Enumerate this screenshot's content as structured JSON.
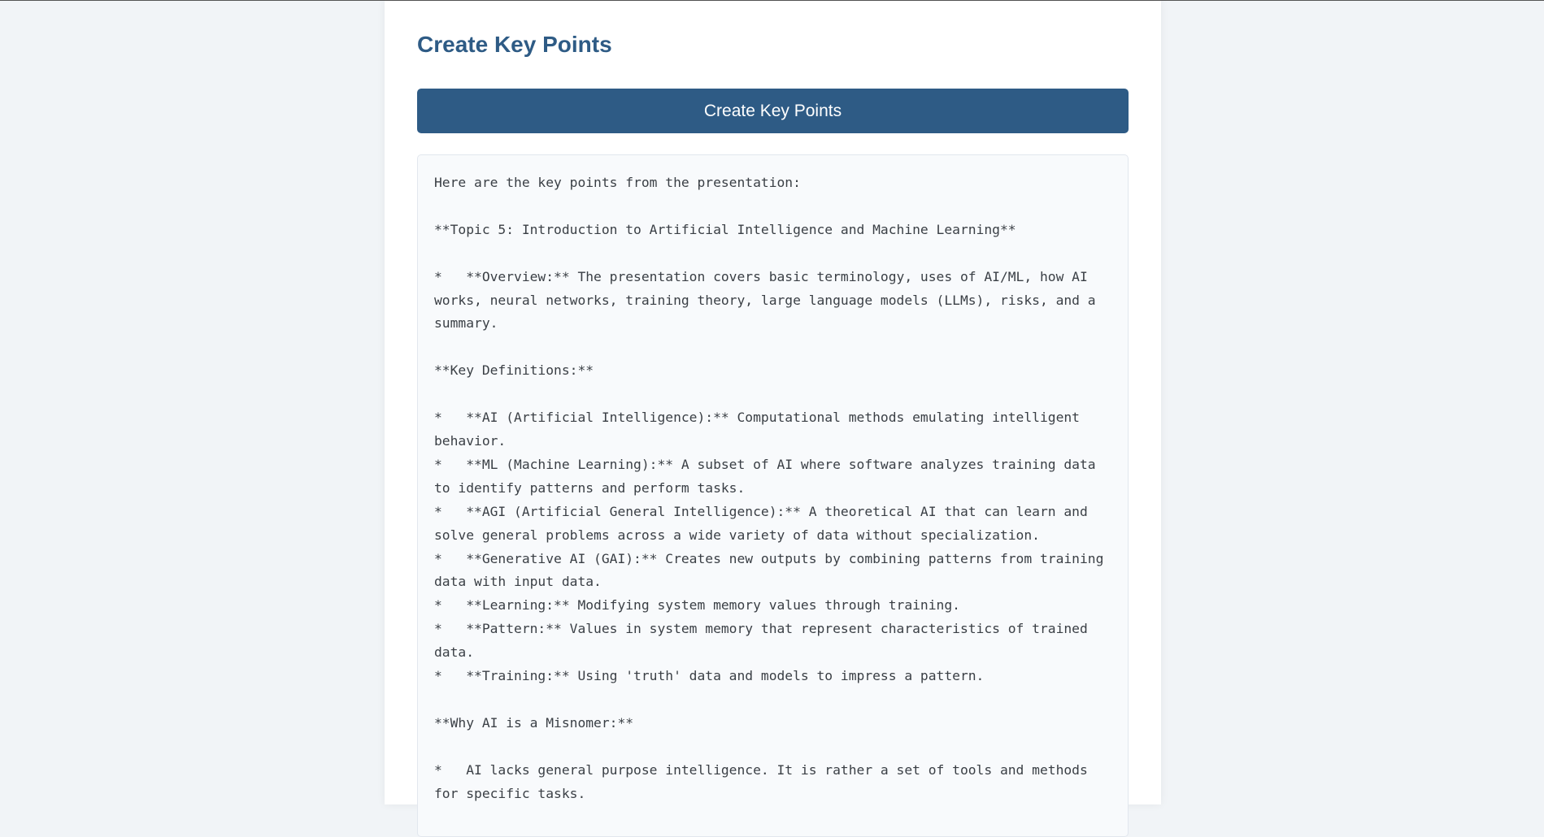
{
  "page": {
    "title": "Create Key Points",
    "button_label": "Create Key Points",
    "output_text": "Here are the key points from the presentation:\n\n**Topic 5: Introduction to Artificial Intelligence and Machine Learning**\n\n*   **Overview:** The presentation covers basic terminology, uses of AI/ML, how AI works, neural networks, training theory, large language models (LLMs), risks, and a summary.\n\n**Key Definitions:**\n\n*   **AI (Artificial Intelligence):** Computational methods emulating intelligent behavior.\n*   **ML (Machine Learning):** A subset of AI where software analyzes training data to identify patterns and perform tasks.\n*   **AGI (Artificial General Intelligence):** A theoretical AI that can learn and solve general problems across a wide variety of data without specialization.\n*   **Generative AI (GAI):** Creates new outputs by combining patterns from training data with input data.\n*   **Learning:** Modifying system memory values through training.\n*   **Pattern:** Values in system memory that represent characteristics of trained data.\n*   **Training:** Using 'truth' data and models to impress a pattern.\n\n**Why AI is a Misnomer:**\n\n*   AI lacks general purpose intelligence. It is rather a set of tools and methods for specific tasks."
  },
  "colors": {
    "accent": "#2e5b85",
    "background": "#f1f4f7",
    "card": "#ffffff",
    "panel": "#f8fafc",
    "text": "#3a3f45"
  }
}
